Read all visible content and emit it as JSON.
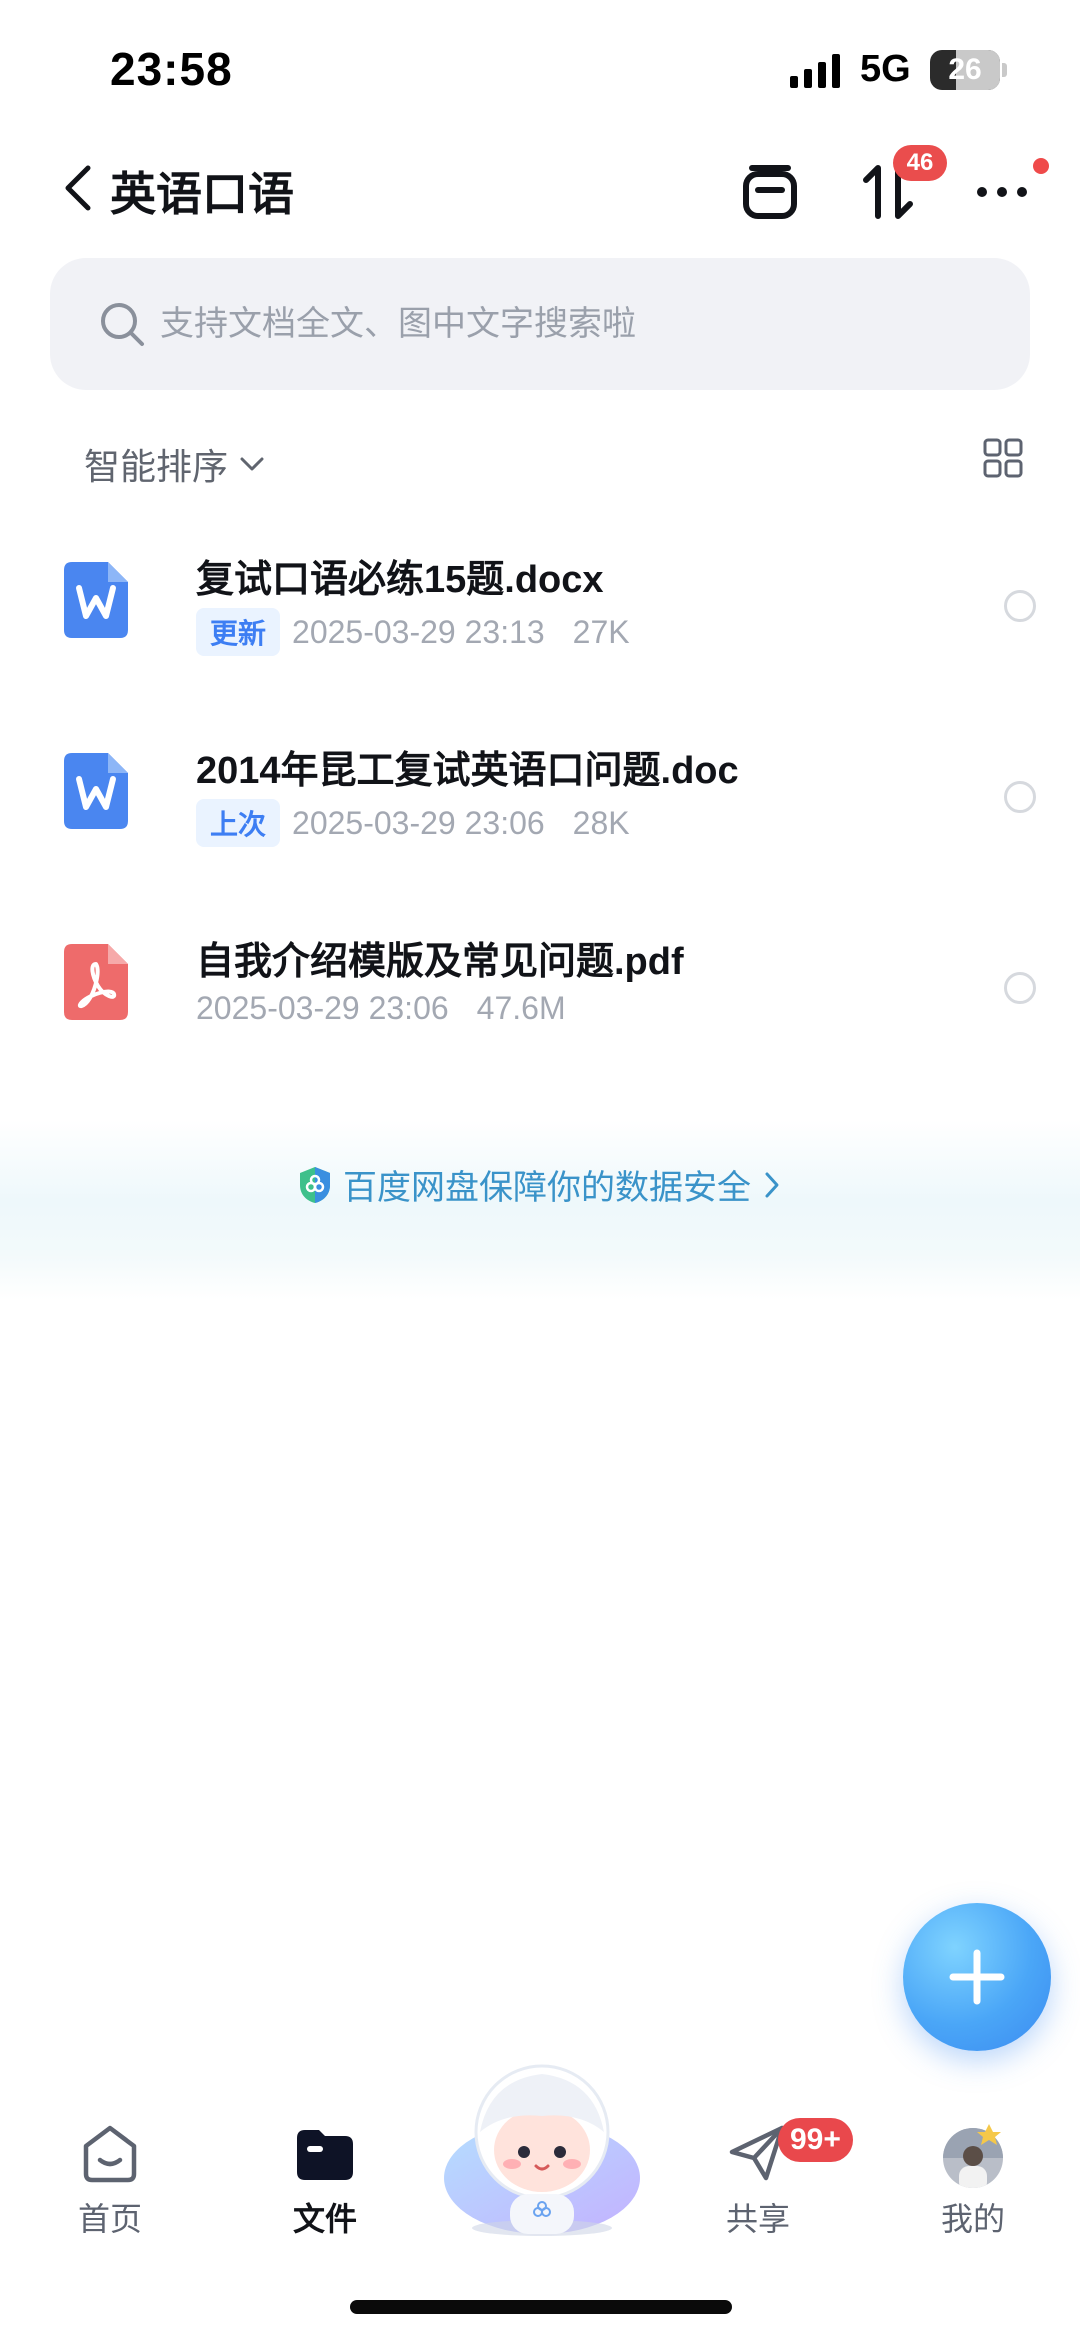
{
  "status_bar": {
    "time": "23:58",
    "network": "5G",
    "battery": "26"
  },
  "header": {
    "title": "英语口语",
    "transfer_badge": "46",
    "icons": [
      "back-chevron-icon",
      "clipboard-icon",
      "transfer-icon",
      "more-icon"
    ]
  },
  "search": {
    "placeholder": "支持文档全文、图中文字搜索啦"
  },
  "sort": {
    "label": "智能排序"
  },
  "files": [
    {
      "name": "复试口语必练15题.docx",
      "tag": "更新",
      "date": "2025-03-29 23:13",
      "size": "27K",
      "type": "word"
    },
    {
      "name": "2014年昆工复试英语口问题.doc",
      "tag": "上次",
      "date": "2025-03-29 23:06",
      "size": "28K",
      "type": "word"
    },
    {
      "name": "自我介绍模版及常见问题.pdf",
      "tag": "",
      "date": "2025-03-29 23:06",
      "size": "47.6M",
      "type": "pdf"
    }
  ],
  "banner": {
    "text": "百度网盘保障你的数据安全"
  },
  "bottom_nav": {
    "home": "首页",
    "files": "文件",
    "share": "共享",
    "share_badge": "99+",
    "mine": "我的"
  },
  "colors": {
    "accent_blue": "#3d7ef3",
    "word_icon": "#4a86f0",
    "pdf_icon": "#ee6b6b",
    "badge_red": "#e9484c",
    "banner_text": "#3a93c9"
  }
}
